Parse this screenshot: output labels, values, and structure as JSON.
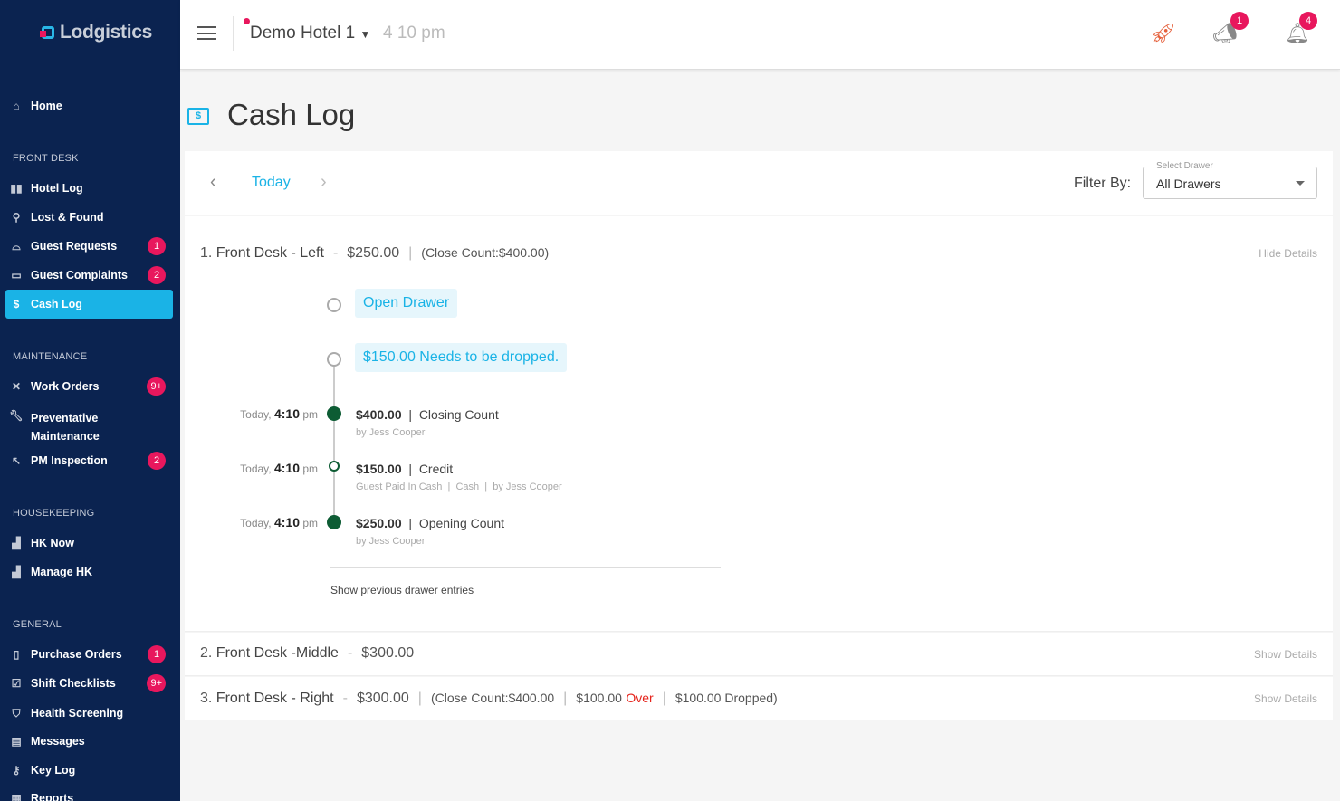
{
  "app": {
    "logo": "Lodgistics"
  },
  "sidebar": {
    "home": "Home",
    "sections": {
      "front_desk": "FRONT DESK",
      "maintenance": "MAINTENANCE",
      "housekeeping": "HOUSEKEEPING",
      "general": "GENERAL"
    },
    "items": [
      {
        "label": "Hotel Log",
        "icon": "hotel-log-icon"
      },
      {
        "label": "Lost & Found",
        "icon": "search-icon"
      },
      {
        "label": "Guest Requests",
        "badge": "1",
        "icon": "bell-icon"
      },
      {
        "label": "Guest Complaints",
        "badge": "2",
        "icon": "complaint-icon"
      },
      {
        "label": "Cash Log",
        "icon": "cash-icon",
        "active": true
      },
      {
        "label": "Work Orders",
        "badge": "9+",
        "icon": "tools-icon"
      },
      {
        "label": "Preventative",
        "label2": "Maintenance",
        "icon": "wrench-icon"
      },
      {
        "label": "PM Inspection",
        "badge": "2",
        "icon": "inspection-icon"
      },
      {
        "label": "HK Now",
        "icon": "hk-icon"
      },
      {
        "label": "Manage HK",
        "icon": "hk-icon"
      },
      {
        "label": "Purchase Orders",
        "badge": "1",
        "icon": "clipboard-icon"
      },
      {
        "label": "Shift Checklists",
        "badge": "9+",
        "icon": "checklist-icon"
      },
      {
        "label": "Health Screening",
        "icon": "shield-icon"
      },
      {
        "label": "Messages",
        "icon": "message-icon"
      },
      {
        "label": "Key Log",
        "icon": "key-icon"
      },
      {
        "label": "Reports",
        "icon": "report-icon"
      }
    ]
  },
  "topbar": {
    "hotel": "Demo Hotel 1",
    "time": "4 10 pm",
    "announce_badge": "1",
    "notif_badge": "4"
  },
  "page": {
    "title": "Cash Log"
  },
  "datebar": {
    "today": "Today",
    "filter_label": "Filter By:",
    "select_label": "Select Drawer",
    "select_value": "All Drawers"
  },
  "drawers": [
    {
      "num": "1.",
      "name": "Front Desk - Left",
      "amount": "$250.00",
      "close": "(Close Count:$400.00)",
      "toggle": "Hide Details",
      "open_drawer": "Open Drawer",
      "drop_msg": "$150.00 Needs to be dropped.",
      "entries": [
        {
          "day": "Today,",
          "time": "4:10",
          "ampm": "pm",
          "amount": "$400.00",
          "type": "Closing Count",
          "sub": "by Jess Cooper"
        },
        {
          "day": "Today,",
          "time": "4:10",
          "ampm": "pm",
          "amount": "$150.00",
          "type": "Credit",
          "sub": "Guest Paid In Cash  |  Cash  |  by Jess Cooper"
        },
        {
          "day": "Today,",
          "time": "4:10",
          "ampm": "pm",
          "amount": "$250.00",
          "type": "Opening Count",
          "sub": "by Jess Cooper"
        }
      ],
      "show_prev": "Show previous drawer entries"
    },
    {
      "num": "2.",
      "name": "Front Desk -Middle",
      "amount": "$300.00",
      "toggle": "Show Details"
    },
    {
      "num": "3.",
      "name": "Front Desk - Right",
      "amount": "$300.00",
      "close": "(Close Count:$400.00",
      "over_amt": "$100.00",
      "over": "Over",
      "dropped": "$100.00 Dropped)",
      "toggle": "Show Details"
    }
  ],
  "colors": {
    "sidebar": "#0b2350",
    "accent": "#1ab3e6",
    "badge": "#e8175d",
    "green": "#0d5c34",
    "over": "#e5231b"
  }
}
